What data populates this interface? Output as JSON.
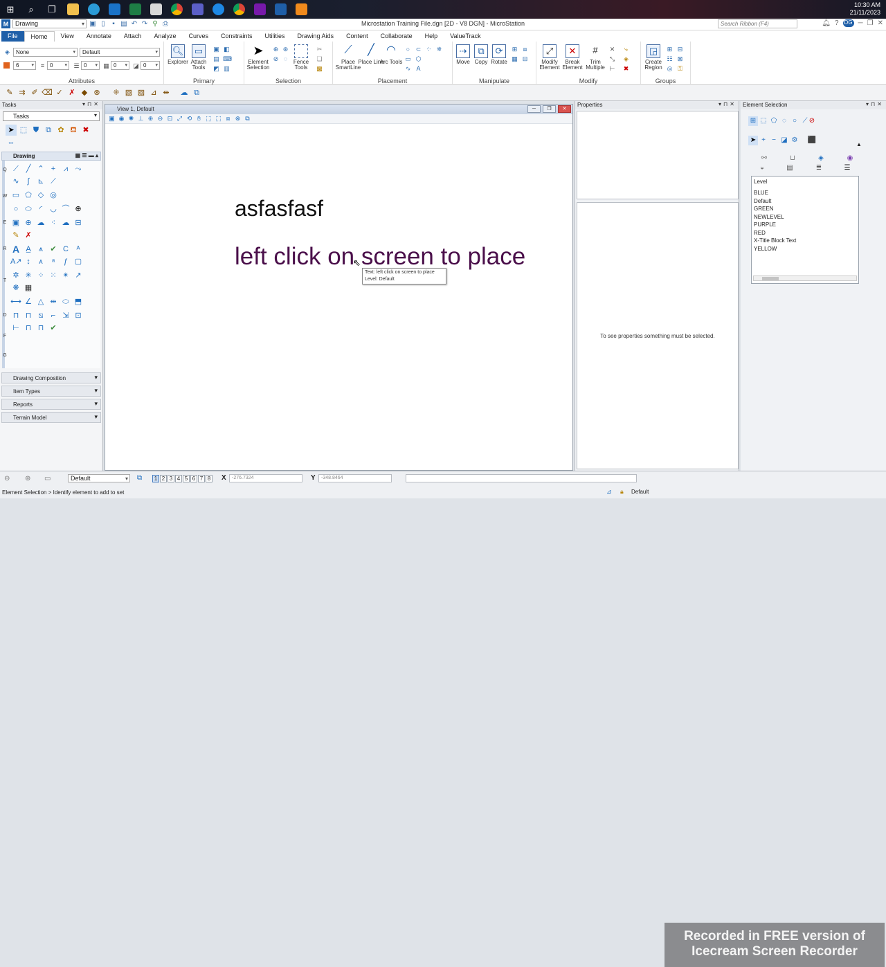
{
  "taskbar": {
    "time": "10:30 AM",
    "date": "21/11/2023"
  },
  "titlebar": {
    "workflow": "Drawing",
    "window_title": "Microstation Training File.dgn [2D - V8 DGN] - MicroStation",
    "search_placeholder": "Search Ribbon (F4)",
    "user_initials": "DG"
  },
  "tabs": [
    "File",
    "Home",
    "View",
    "Annotate",
    "Attach",
    "Analyze",
    "Curves",
    "Constraints",
    "Utilities",
    "Drawing Aids",
    "Content",
    "Collaborate",
    "Help",
    "ValueTrack"
  ],
  "ribbon": {
    "attributes": {
      "label": "Attributes",
      "level": "None",
      "style": "Default",
      "color": "6",
      "weight1": "0",
      "weight2": "0",
      "weight3": "0",
      "weight4": "0"
    },
    "primary": {
      "label": "Primary",
      "explorer": "Explorer",
      "attach_tools": "Attach Tools"
    },
    "selection": {
      "label": "Selection",
      "element_selection": "Element Selection",
      "fence_tools": "Fence Tools"
    },
    "placement": {
      "label": "Placement",
      "place_smartline": "Place SmartLine",
      "place_line": "Place Line",
      "arc_tools": "Arc Tools"
    },
    "manipulate": {
      "label": "Manipulate",
      "move": "Move",
      "copy": "Copy",
      "rotate": "Rotate"
    },
    "modify": {
      "label": "Modify",
      "modify_element": "Modify Element",
      "break_element": "Break Element",
      "trim_multiple": "Trim Multiple"
    },
    "groups": {
      "label": "Groups",
      "create_region": "Create Region"
    }
  },
  "tasks": {
    "title": "Tasks",
    "combo": "Tasks",
    "drawing": "Drawing",
    "collapsed": [
      "Drawing Composition",
      "Item Types",
      "Reports",
      "Terrain Model"
    ]
  },
  "view": {
    "title": "View 1, Default",
    "text1": "asfasfasf",
    "text2": "left click on screen to place",
    "tooltip_line1": "Text: left click on screen to place",
    "tooltip_line2": "Level: Default"
  },
  "properties": {
    "title": "Properties",
    "message": "To see properties something must be selected."
  },
  "element_selection": {
    "title": "Element Selection",
    "level_header": "Level",
    "levels": [
      "BLUE",
      "Default",
      "GREEN",
      "NEWLEVEL",
      "PURPLE",
      "RED",
      "X-Title Block Text",
      "YELLOW"
    ]
  },
  "status": {
    "view_group": "Default",
    "pages": [
      "1",
      "2",
      "3",
      "4",
      "5",
      "6",
      "7",
      "8"
    ],
    "x_label": "X",
    "x_value": "-276.7324",
    "y_label": "Y",
    "y_value": "-348.8464",
    "prompt": "Element Selection > Identify element to add to set",
    "level": "Default"
  },
  "watermark": {
    "line1": "Recorded in FREE version of",
    "line2": "Icecream Screen Recorder"
  },
  "colors": {
    "accent": "#1f5fa8",
    "text_purple": "#4a0f4a"
  }
}
